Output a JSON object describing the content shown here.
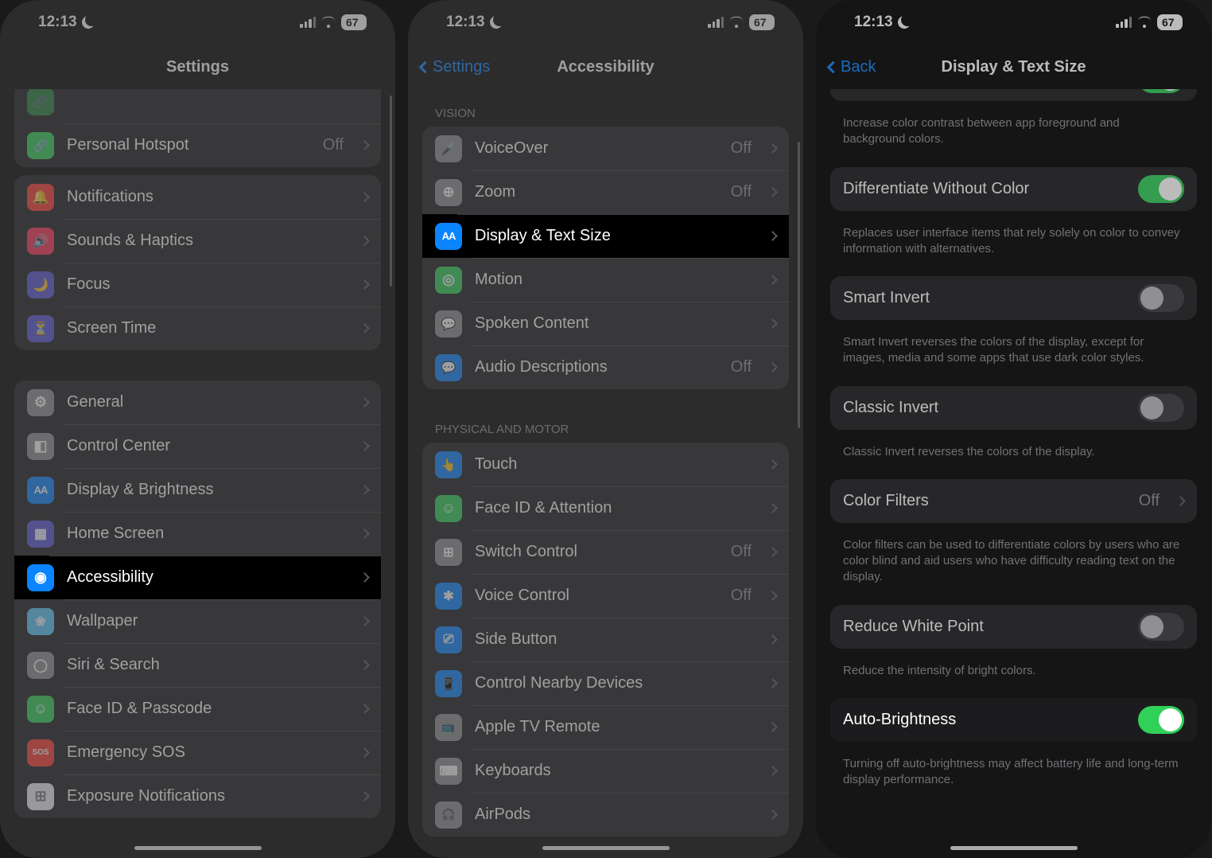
{
  "status": {
    "time": "12:13",
    "battery": "67"
  },
  "screen1": {
    "title": "Settings",
    "partial_row": {
      "label": "Personal Hotspot",
      "value": "Off"
    },
    "group_a": [
      {
        "label": "Notifications",
        "icon": "g-bell",
        "bg": "bg-red"
      },
      {
        "label": "Sounds & Haptics",
        "icon": "g-speaker",
        "bg": "bg-pink"
      },
      {
        "label": "Focus",
        "icon": "g-moon2",
        "bg": "bg-indigo"
      },
      {
        "label": "Screen Time",
        "icon": "g-hourglass",
        "bg": "bg-indigo"
      }
    ],
    "group_b": [
      {
        "label": "General",
        "icon": "g-gear",
        "bg": "bg-gray"
      },
      {
        "label": "Control Center",
        "icon": "g-toggle",
        "bg": "bg-gray"
      },
      {
        "label": "Display & Brightness",
        "icon": "g-aa",
        "bg": "bg-blue"
      },
      {
        "label": "Home Screen",
        "icon": "g-grid",
        "bg": "bg-indigo"
      },
      {
        "label": "Accessibility",
        "icon": "g-person",
        "bg": "bg-blue",
        "highlight": true
      },
      {
        "label": "Wallpaper",
        "icon": "g-wall",
        "bg": "bg-teal"
      },
      {
        "label": "Siri & Search",
        "icon": "g-circle",
        "bg": "bg-gray"
      },
      {
        "label": "Face ID & Passcode",
        "icon": "g-face",
        "bg": "bg-green"
      },
      {
        "label": "Emergency SOS",
        "icon": "g-sos",
        "bg": "bg-red"
      },
      {
        "label": "Exposure Notifications",
        "icon": "g-dots",
        "bg": "bg-white"
      }
    ]
  },
  "screen2": {
    "back": "Settings",
    "title": "Accessibility",
    "vision_header": "VISION",
    "vision": [
      {
        "label": "VoiceOver",
        "value": "Off",
        "icon": "g-mic",
        "bg": "bg-gray"
      },
      {
        "label": "Zoom",
        "value": "Off",
        "icon": "g-zoom",
        "bg": "bg-gray"
      },
      {
        "label": "Display & Text Size",
        "icon": "g-aa",
        "bg": "bg-blue",
        "highlight": true
      },
      {
        "label": "Motion",
        "icon": "g-motion",
        "bg": "bg-green"
      },
      {
        "label": "Spoken Content",
        "icon": "g-spoken",
        "bg": "bg-gray"
      },
      {
        "label": "Audio Descriptions",
        "value": "Off",
        "icon": "g-audio",
        "bg": "bg-blue"
      }
    ],
    "motor_header": "PHYSICAL AND MOTOR",
    "motor": [
      {
        "label": "Touch",
        "icon": "g-touch",
        "bg": "bg-blue"
      },
      {
        "label": "Face ID & Attention",
        "icon": "g-face",
        "bg": "bg-green"
      },
      {
        "label": "Switch Control",
        "value": "Off",
        "icon": "g-grid4",
        "bg": "bg-gray"
      },
      {
        "label": "Voice Control",
        "value": "Off",
        "icon": "g-cmd",
        "bg": "bg-blue"
      },
      {
        "label": "Side Button",
        "icon": "g-side",
        "bg": "bg-blue"
      },
      {
        "label": "Control Nearby Devices",
        "icon": "g-phone",
        "bg": "bg-blue"
      },
      {
        "label": "Apple TV Remote",
        "icon": "g-tv",
        "bg": "bg-gray"
      },
      {
        "label": "Keyboards",
        "icon": "g-kb",
        "bg": "bg-gray"
      },
      {
        "label": "AirPods",
        "icon": "g-airpod",
        "bg": "bg-gray"
      }
    ]
  },
  "screen3": {
    "back": "Back",
    "title": "Display & Text Size",
    "intro_footer": "Increase color contrast between app foreground and background colors.",
    "items": [
      {
        "label": "Differentiate Without Color",
        "on": true,
        "footer": "Replaces user interface items that rely solely on color to convey information with alternatives."
      },
      {
        "label": "Smart Invert",
        "on": false,
        "footer": "Smart Invert reverses the colors of the display, except for images, media and some apps that use dark color styles."
      },
      {
        "label": "Classic Invert",
        "on": false,
        "footer": "Classic Invert reverses the colors of the display."
      },
      {
        "label": "Color Filters",
        "value": "Off",
        "footer": "Color filters can be used to differentiate colors by users who are color blind and aid users who have difficulty reading text on the display."
      },
      {
        "label": "Reduce White Point",
        "on": false,
        "footer": "Reduce the intensity of bright colors."
      },
      {
        "label": "Auto-Brightness",
        "on": true,
        "highlight": true,
        "footer": "Turning off auto-brightness may affect battery life and long-term display performance."
      }
    ]
  }
}
